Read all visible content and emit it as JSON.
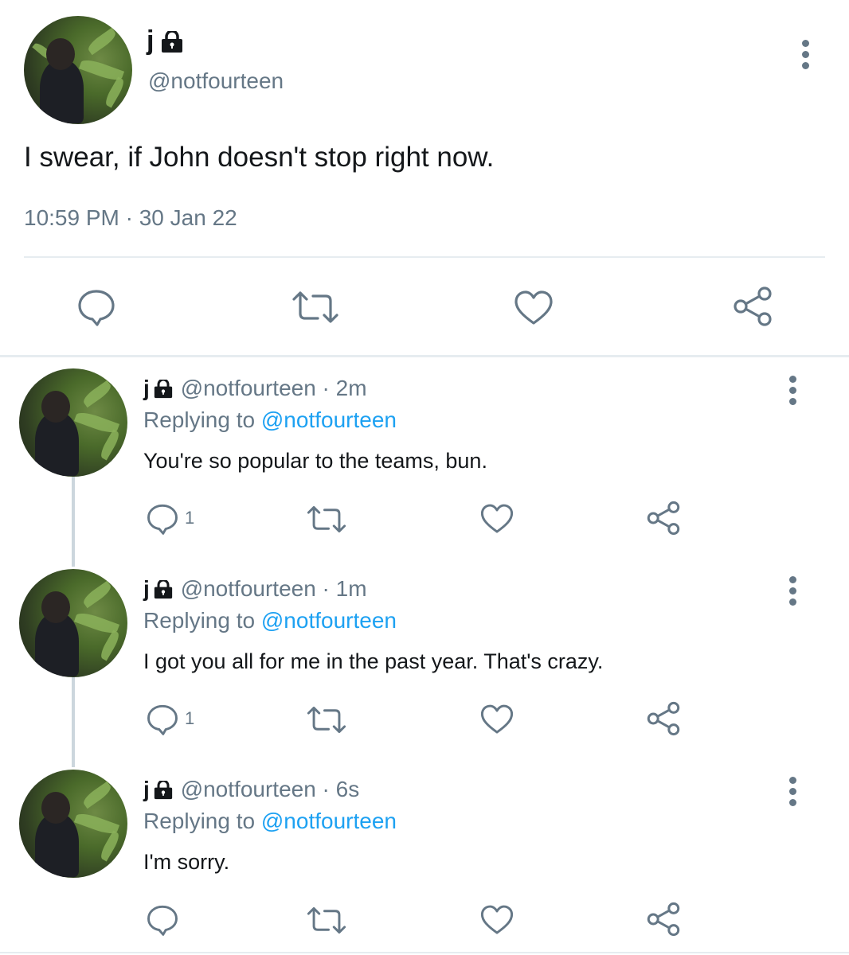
{
  "main_tweet": {
    "display_name": "j",
    "handle": "@notfourteen",
    "text": "I swear, if John doesn't stop right now.",
    "timestamp": "10:59 PM · 30 Jan 22"
  },
  "main_actions": [
    "reply-icon",
    "retweet-icon",
    "like-icon",
    "share-icon"
  ],
  "replies": [
    {
      "display_name": "j",
      "handle": "@notfourteen",
      "time": "2m",
      "replying_prefix": "Replying to",
      "replying_handle": "@notfourteen",
      "text": "You're so popular to the teams, bun.",
      "reply_count": "1"
    },
    {
      "display_name": "j",
      "handle": "@notfourteen",
      "time": "1m",
      "replying_prefix": "Replying to",
      "replying_handle": "@notfourteen",
      "text": "I got you all for me in the past year. That's crazy.",
      "reply_count": "1"
    },
    {
      "display_name": "j",
      "handle": "@notfourteen",
      "time": "6s",
      "replying_prefix": "Replying to",
      "replying_handle": "@notfourteen",
      "text": "I'm sorry.",
      "reply_count": ""
    }
  ],
  "colors": {
    "accent": "#1da1f2",
    "secondary_text": "#657786",
    "divider": "#e6ecf0",
    "thread_line": "#ccd6dd"
  }
}
